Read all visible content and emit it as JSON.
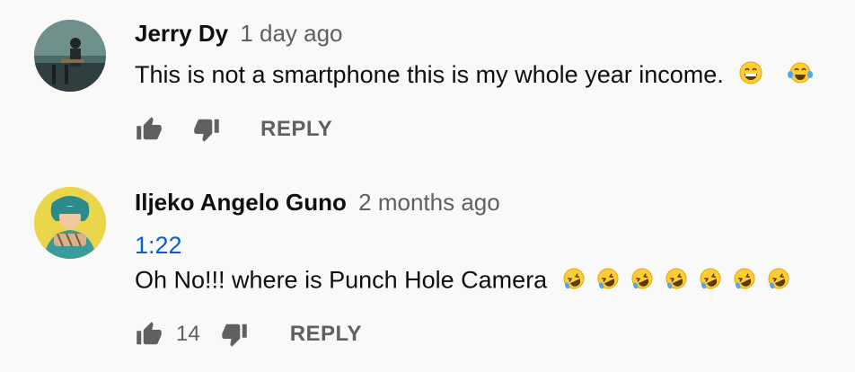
{
  "comments": [
    {
      "author": "Jerry Dy",
      "time": "1 day ago",
      "text": "This is not a smartphone this is my whole year income.",
      "emojis": [
        "grinning-face",
        "face-with-tears-of-joy"
      ],
      "reply_label": "REPLY"
    },
    {
      "author": "Iljeko Angelo Guno",
      "time": "2 months ago",
      "timestamp_link": "1:22",
      "text": "Oh No!!! where is Punch Hole Camera",
      "emojis": [
        "rolling-on-floor-laughing",
        "rolling-on-floor-laughing",
        "rolling-on-floor-laughing",
        "rolling-on-floor-laughing",
        "rolling-on-floor-laughing",
        "rolling-on-floor-laughing",
        "rolling-on-floor-laughing"
      ],
      "like_count": "14",
      "reply_label": "REPLY"
    }
  ],
  "colors": {
    "background": "#f9f9f9",
    "secondary_text": "#606060",
    "link": "#065fd4"
  }
}
